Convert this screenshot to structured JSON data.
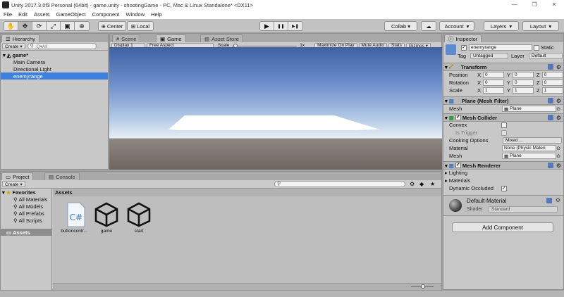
{
  "window": {
    "title": "Unity 2017.3.0f3 Personal (64bit) - game.unity - shootingGame - PC, Mac & Linux Standalone* <DX11>",
    "controls": [
      "—",
      "❐",
      "✕"
    ]
  },
  "menu": [
    "File",
    "Edit",
    "Assets",
    "GameObject",
    "Component",
    "Window",
    "Help"
  ],
  "toolbar": {
    "tools": [
      "✋",
      "✥",
      "⟳",
      "⤢",
      "▣",
      "⊕"
    ],
    "pivot": "Center",
    "space": "Local",
    "play": "▶",
    "pause": "❚❚",
    "step": "▶❚",
    "collab": "Collab ▾",
    "cloud": "☁",
    "account": "Account",
    "layers": "Layers",
    "layout": "Layout"
  },
  "hierarchy": {
    "tab": "Hierarchy",
    "create": "Create ▾",
    "search_placeholder": "Q▾All",
    "scene": "game*",
    "items": [
      "Main Camera",
      "Directional Light",
      "enemyrange"
    ],
    "selected_index": 2
  },
  "gamepanel": {
    "tabs": [
      "Scene",
      "Game",
      "Asset Store"
    ],
    "active_tab": "Game",
    "display": "Display 1",
    "aspect": "Free Aspect",
    "scale_label": "Scale",
    "scale_value": "1x",
    "options": [
      "Maximize On Play",
      "Mute Audio",
      "Stats",
      "Gizmos ▾"
    ]
  },
  "project": {
    "tabs": [
      "Project",
      "Console"
    ],
    "create": "Create ▾",
    "favorites_label": "Favorites",
    "favorites": [
      "All Materials",
      "All Models",
      "All Prefabs",
      "All Scripts"
    ],
    "assets_root": "Assets",
    "assets_header": "Assets",
    "assets": [
      {
        "name": "buttoncontr...",
        "icon": "csharp-script-icon"
      },
      {
        "name": "game",
        "icon": "unity-scene-icon"
      },
      {
        "name": "start",
        "icon": "unity-scene-icon"
      }
    ]
  },
  "inspector": {
    "tab": "Inspector",
    "object_name": "enemyrange",
    "static_label": "Static",
    "tag_label": "Tag",
    "tag_value": "Untagged",
    "layer_label": "Layer",
    "layer_value": "Default",
    "transform": {
      "title": "Transform",
      "rows": [
        {
          "label": "Position",
          "x": "0",
          "y": "0",
          "z": "0"
        },
        {
          "label": "Rotation",
          "x": "0",
          "y": "0",
          "z": "0"
        },
        {
          "label": "Scale",
          "x": "1",
          "y": "1",
          "z": "1"
        }
      ]
    },
    "mesh_filter": {
      "title": "Plane (Mesh Filter)",
      "mesh_label": "Mesh",
      "mesh_value": "Plane"
    },
    "mesh_collider": {
      "title": "Mesh Collider",
      "convex_label": "Convex",
      "trigger_label": "Is Trigger",
      "cooking_label": "Cooking Options",
      "cooking_value": "Mixed ...",
      "material_label": "Material",
      "material_value": "None (Physic Materi",
      "mesh_label": "Mesh",
      "mesh_value": "Plane"
    },
    "mesh_renderer": {
      "title": "Mesh Renderer",
      "lighting": "Lighting",
      "materials": "Materials",
      "dynamic_occluded": "Dynamic Occluded"
    },
    "material": {
      "name": "Default-Material",
      "shader_label": "Shader",
      "shader_value": "Standard"
    },
    "add_component": "Add Component"
  }
}
